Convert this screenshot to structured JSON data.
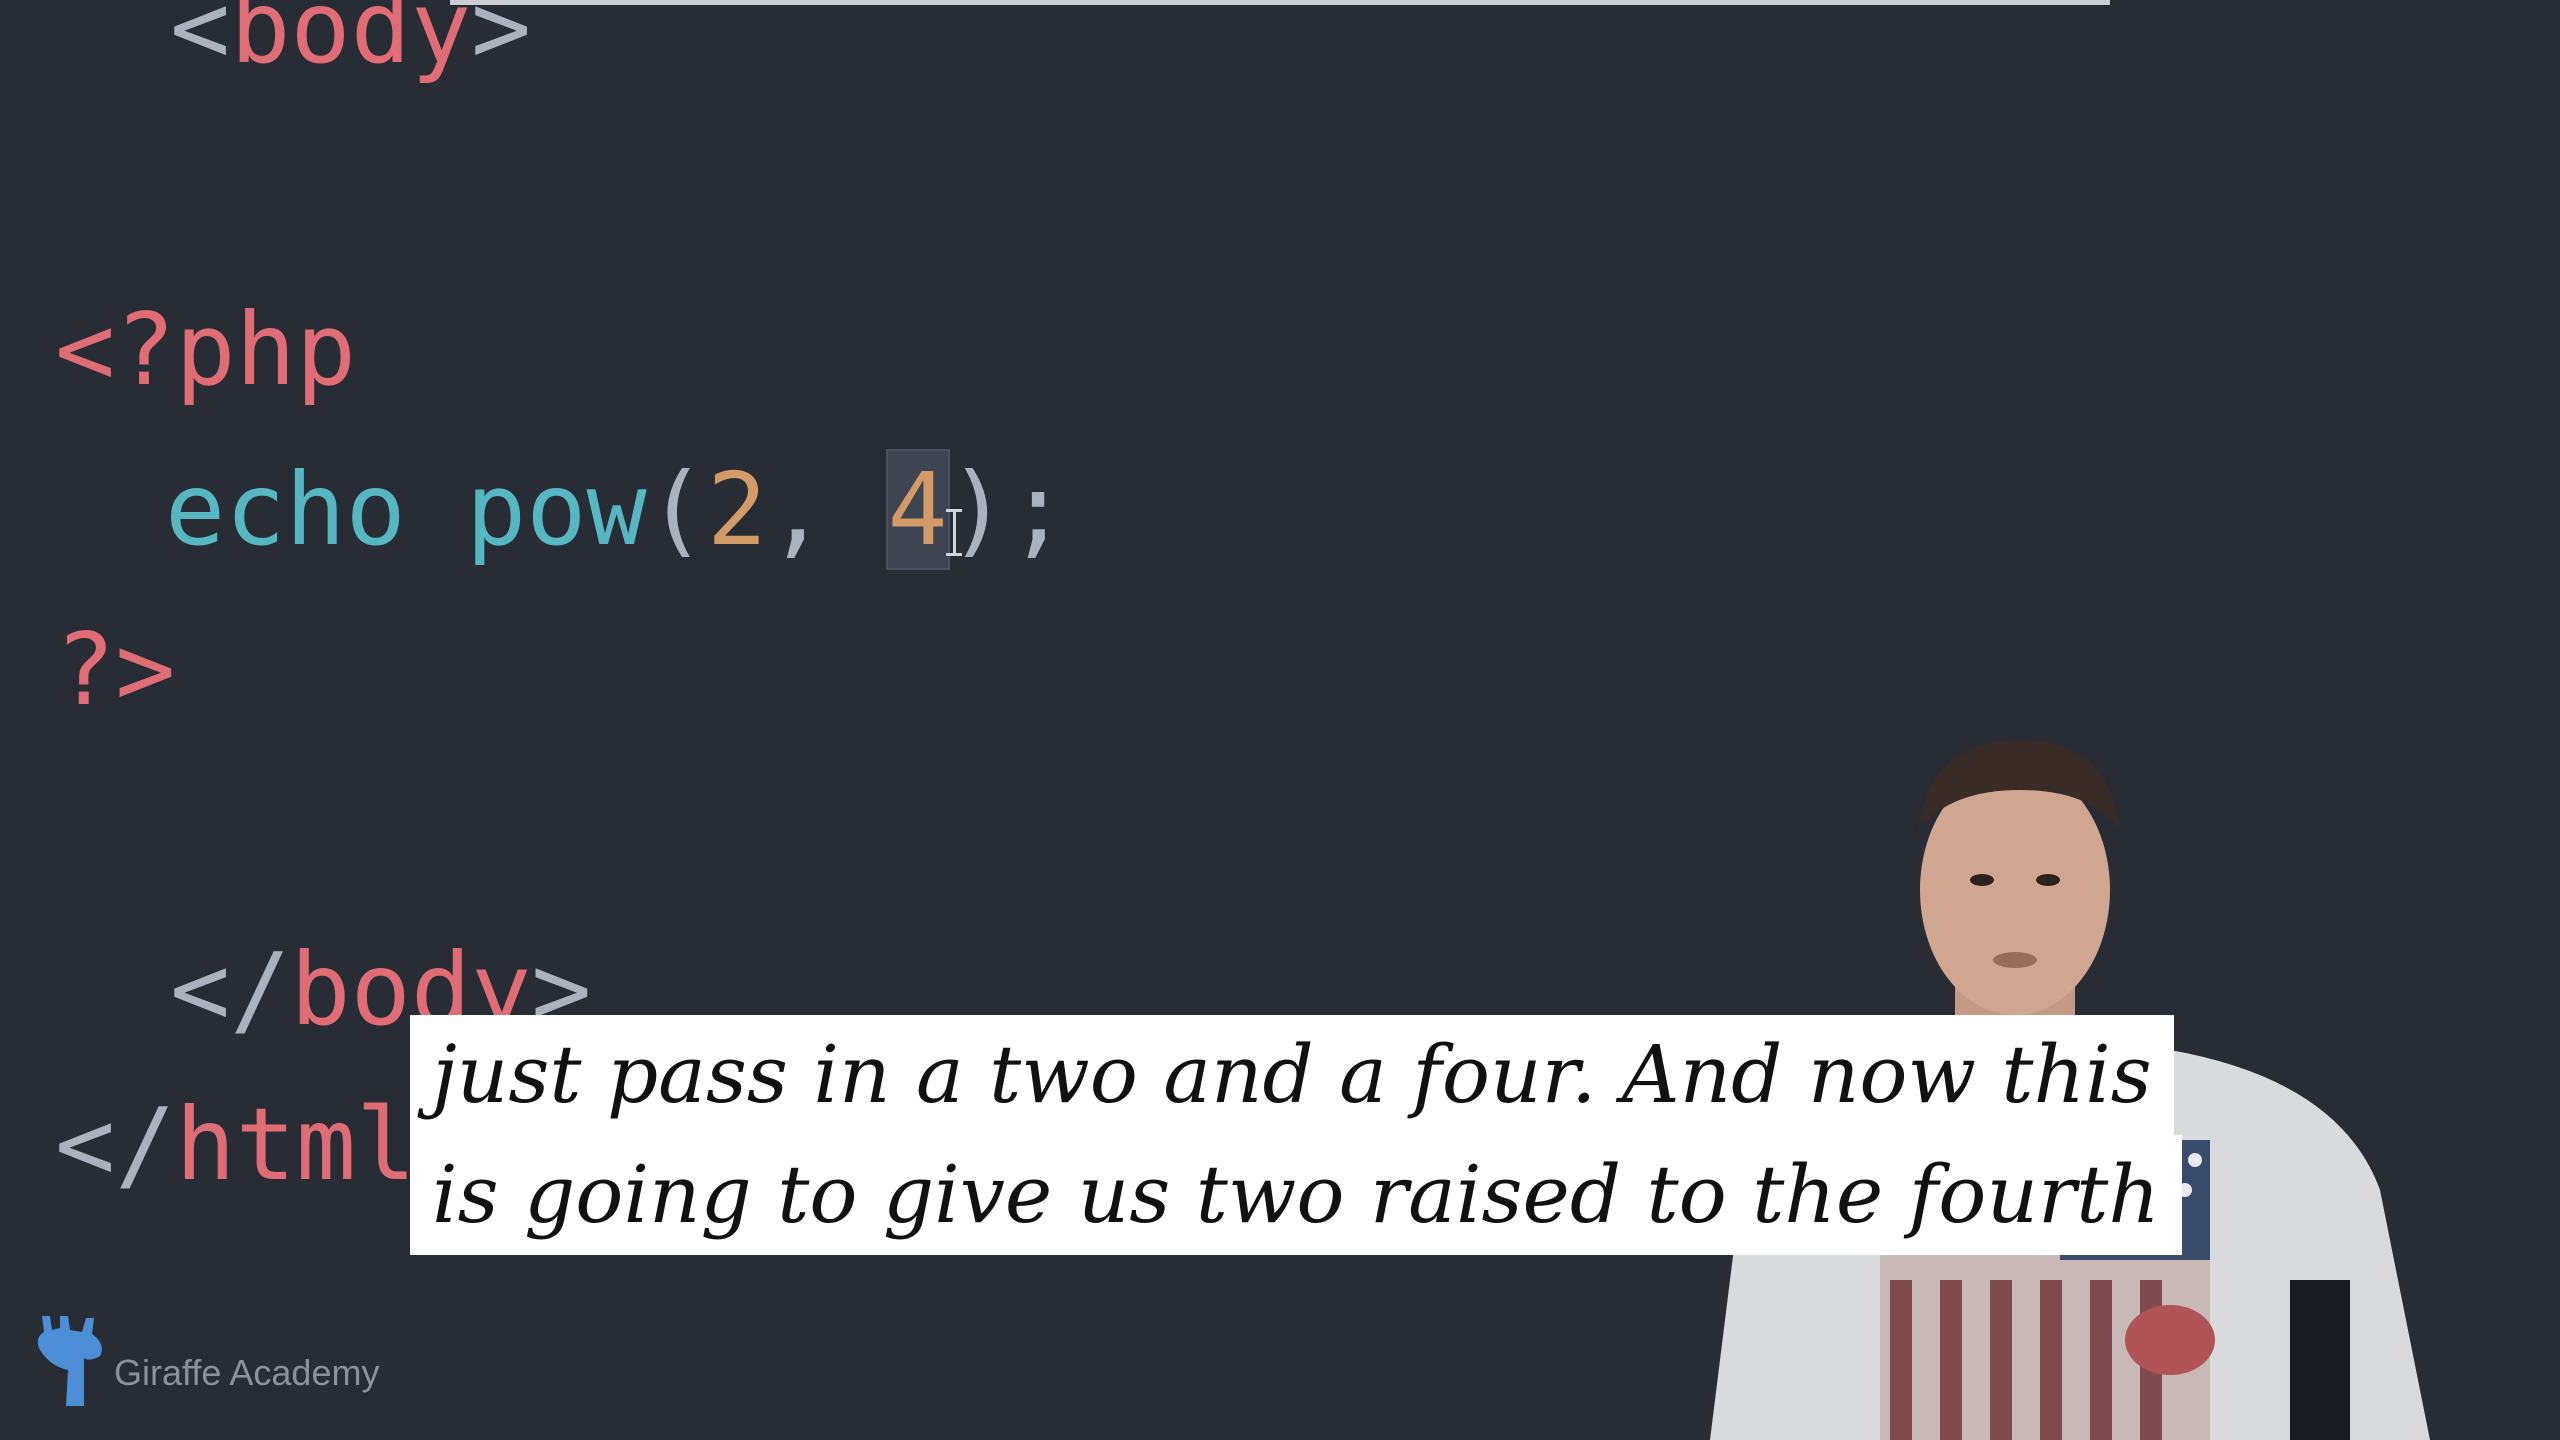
{
  "code": {
    "line_body_open": {
      "open": "<",
      "name": "body",
      "close": ">"
    },
    "line_php_open": {
      "text": "<?php"
    },
    "line_echo": {
      "kw": "echo",
      "fn": "pow",
      "paren_open": "(",
      "arg1": "2",
      "comma": ",",
      "arg2": "4",
      "paren_close": ")",
      "semi": ";"
    },
    "line_php_close": {
      "text": "?>"
    },
    "line_body_close": {
      "open": "</",
      "name": "body",
      "close": ">"
    },
    "line_html_close": {
      "open": "</",
      "name": "html"
    }
  },
  "caption": {
    "line1": "just pass in a two and a four. And now this",
    "line2": "is going to give us two raised to the fourth"
  },
  "watermark": {
    "text": "Giraffe Academy",
    "icon": "giraffe-icon"
  },
  "colors": {
    "background": "#282c35",
    "tag": "#e06c75",
    "keyword": "#56b6c2",
    "number": "#d19a66"
  }
}
